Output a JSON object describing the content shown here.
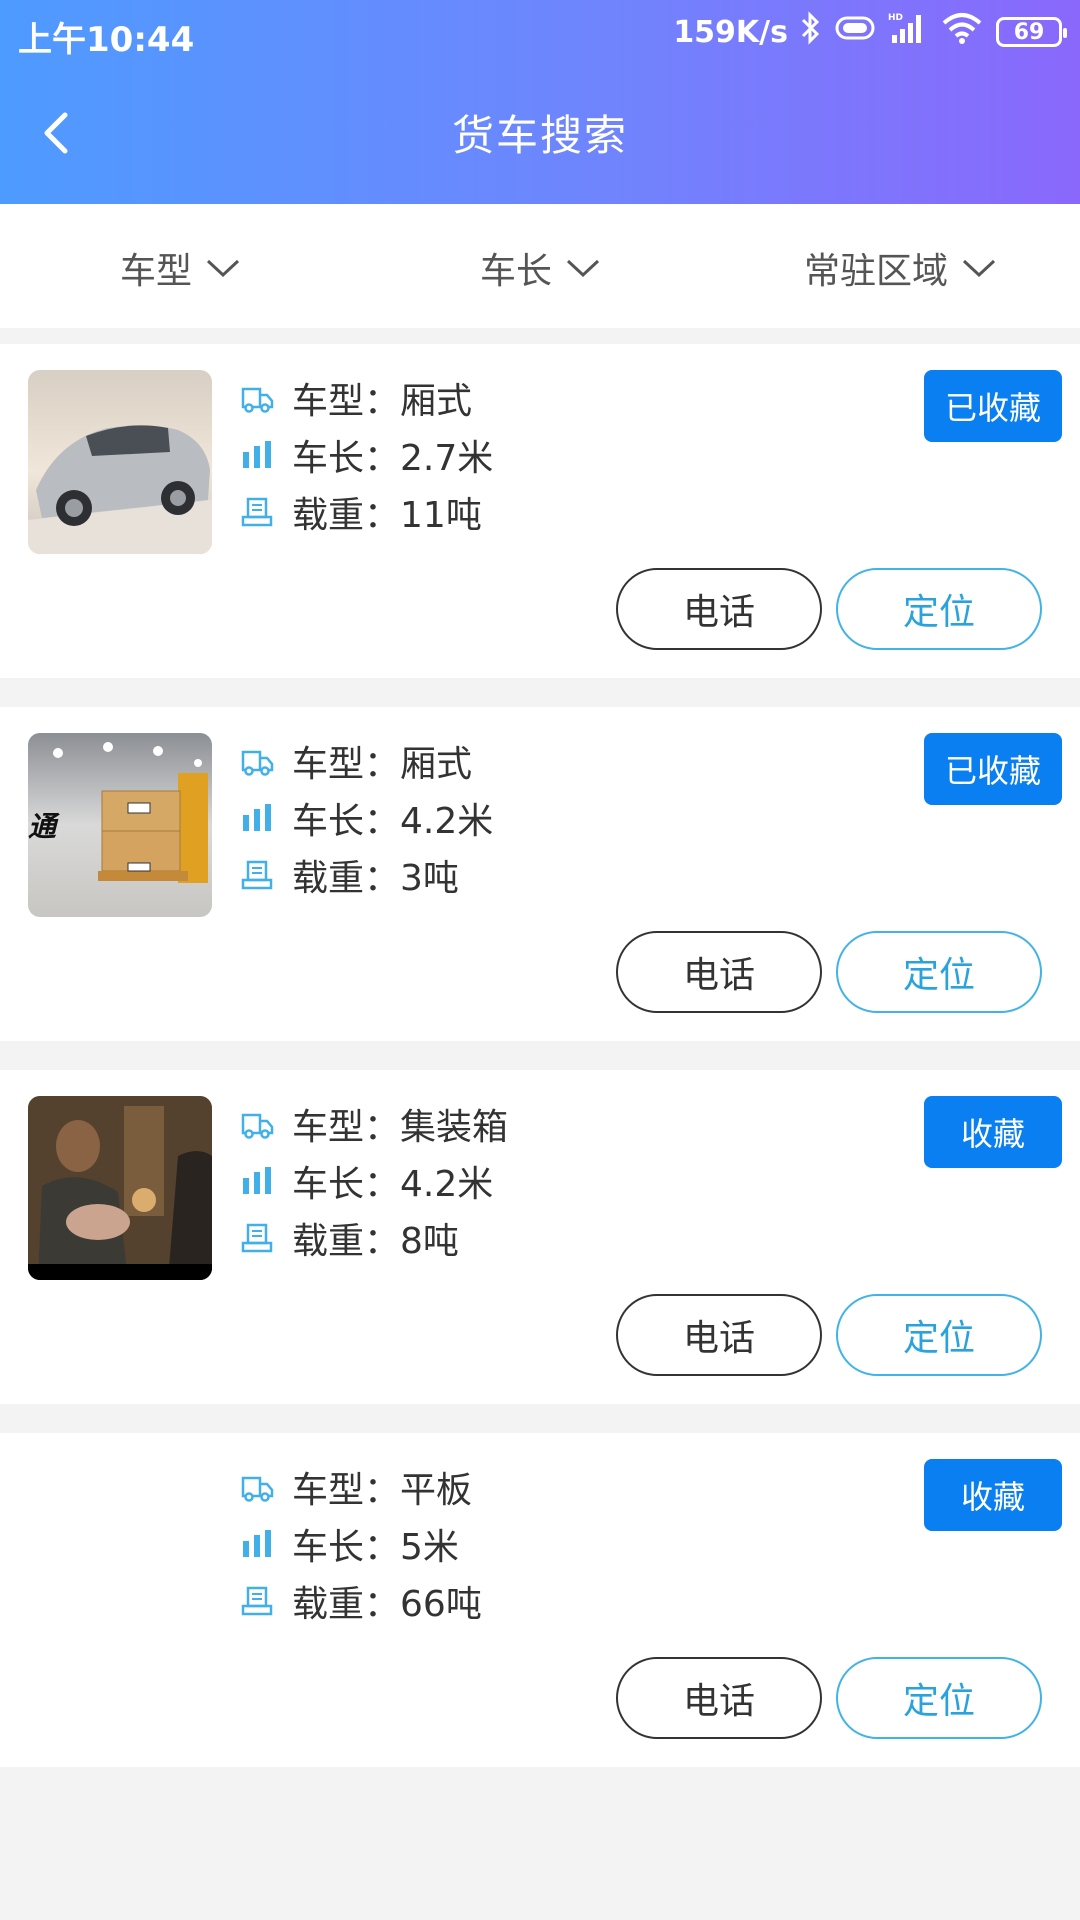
{
  "status_bar": {
    "time": "上午10:44",
    "speed": "159K/s",
    "battery": "69"
  },
  "header": {
    "title": "货车搜索"
  },
  "filters": [
    {
      "label": "车型"
    },
    {
      "label": "车长"
    },
    {
      "label": "常驻区域"
    }
  ],
  "icons": {
    "type": "truck-icon",
    "length": "bar-chart-icon",
    "load": "scale-icon",
    "accent": "#42b0e8"
  },
  "colors": {
    "header_start": "#4e9bff",
    "header_end": "#8a68fc",
    "fav_button": "#0a7ff2",
    "locate_border": "#41b3e6"
  },
  "vehicles": [
    {
      "type_label": "车型：",
      "type_value": "厢式",
      "length_label": "车长：",
      "length_value": "2.7米",
      "load_label": "载重：",
      "load_value": "11吨",
      "fav_label": "已收藏",
      "call_label": "电话",
      "locate_label": "定位",
      "thumb": "car-photo"
    },
    {
      "type_label": "车型：",
      "type_value": "厢式",
      "length_label": "车长：",
      "length_value": "4.2米",
      "load_label": "载重：",
      "load_value": "3吨",
      "fav_label": "已收藏",
      "call_label": "电话",
      "locate_label": "定位",
      "thumb": "forklift-photo",
      "thumb_text": "通"
    },
    {
      "type_label": "车型：",
      "type_value": "集装箱",
      "length_label": "车长：",
      "length_value": "4.2米",
      "load_label": "载重：",
      "load_value": "8吨",
      "fav_label": "收藏",
      "call_label": "电话",
      "locate_label": "定位",
      "thumb": "movie-still-photo"
    },
    {
      "type_label": "车型：",
      "type_value": "平板",
      "length_label": "车长：",
      "length_value": "5米",
      "load_label": "载重：",
      "load_value": "66吨",
      "fav_label": "收藏",
      "call_label": "电话",
      "locate_label": "定位",
      "thumb": "none"
    }
  ]
}
